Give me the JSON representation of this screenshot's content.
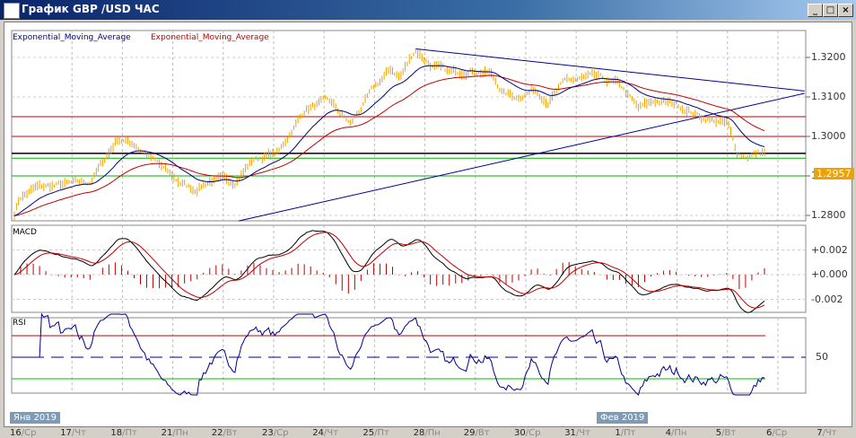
{
  "window": {
    "title": "График GBP /USD ЧАС",
    "buttons": {
      "minimize": "_",
      "maximize": "□",
      "close": "×"
    }
  },
  "legend": {
    "ema1": "Exponential_Moving_Average",
    "ema2": "Exponential_Moving_Average"
  },
  "panels": {
    "macd": "MACD",
    "rsi": "RSI"
  },
  "colors": {
    "price": "#f0a000",
    "ema_fast": "#000080",
    "ema_slow": "#c00000",
    "support": "#00b000",
    "resistance": "#c00000",
    "trend": "#000090"
  },
  "chart_data": {
    "type": "line",
    "price_axis": {
      "ticks": [
        "1.3200",
        "1.3100",
        "1.3000",
        "1.2900",
        "1.2800"
      ],
      "range": [
        1.2775,
        1.3265
      ],
      "last_price": "1.2957"
    },
    "macd_axis": {
      "ticks": [
        "+0.002",
        "+0.000",
        "-0.002"
      ]
    },
    "rsi_axis": {
      "ticks": [
        "50"
      ],
      "levels": [
        70,
        50,
        30
      ]
    },
    "horizontal_lines": [
      {
        "price": 1.305,
        "color": "red"
      },
      {
        "price": 1.3,
        "color": "red"
      },
      {
        "price": 1.2957,
        "color": "black"
      },
      {
        "price": 1.2945,
        "color": "green"
      },
      {
        "price": 1.29,
        "color": "green"
      }
    ],
    "trendlines": [
      {
        "from": [
          7.95,
          1.3222
        ],
        "to": [
          15.67,
          1.3115
        ]
      },
      {
        "from": [
          4.45,
          1.2786
        ],
        "to": [
          15.67,
          1.3109
        ]
      }
    ],
    "price_path_day_index": [
      [
        0,
        1.2805
      ],
      [
        0.1,
        1.2845
      ],
      [
        0.44,
        1.287
      ],
      [
        1.51,
        1.2885
      ],
      [
        2.05,
        1.2995
      ],
      [
        2.4,
        1.298
      ],
      [
        2.85,
        1.293
      ],
      [
        3.2,
        1.289
      ],
      [
        3.56,
        1.2865
      ],
      [
        3.91,
        1.289
      ],
      [
        4.36,
        1.2885
      ],
      [
        4.72,
        1.294
      ],
      [
        5.25,
        1.296
      ],
      [
        5.52,
        1.302
      ],
      [
        5.78,
        1.307
      ],
      [
        6.23,
        1.309
      ],
      [
        6.67,
        1.303
      ],
      [
        7.12,
        1.312
      ],
      [
        7.47,
        1.317
      ],
      [
        7.65,
        1.315
      ],
      [
        7.95,
        1.322
      ],
      [
        8.27,
        1.318
      ],
      [
        8.63,
        1.316
      ],
      [
        9.07,
        1.317
      ],
      [
        9.43,
        1.316
      ],
      [
        9.7,
        1.311
      ],
      [
        9.96,
        1.31
      ],
      [
        10.32,
        1.312
      ],
      [
        10.59,
        1.309
      ],
      [
        10.94,
        1.314
      ],
      [
        11.48,
        1.315
      ],
      [
        12.01,
        1.313
      ],
      [
        12.37,
        1.307
      ],
      [
        12.72,
        1.309
      ],
      [
        13.17,
        1.308
      ],
      [
        13.61,
        1.305
      ],
      [
        14.15,
        1.303
      ],
      [
        14.32,
        1.296
      ],
      [
        14.5,
        1.295
      ],
      [
        14.86,
        1.296
      ]
    ],
    "x_labels": [
      {
        "d": "16",
        "w": "Ср"
      },
      {
        "d": "17",
        "w": "Чт"
      },
      {
        "d": "18",
        "w": "Пт"
      },
      {
        "d": "21",
        "w": "Пн"
      },
      {
        "d": "22",
        "w": "Вт"
      },
      {
        "d": "23",
        "w": "Ср"
      },
      {
        "d": "24",
        "w": "Чт"
      },
      {
        "d": "25",
        "w": "Пт"
      },
      {
        "d": "28",
        "w": "Пн"
      },
      {
        "d": "29",
        "w": "Вт"
      },
      {
        "d": "30",
        "w": "Ср"
      },
      {
        "d": "31",
        "w": "Чт"
      },
      {
        "d": "1",
        "w": "Пт"
      },
      {
        "d": "4",
        "w": "Пн"
      },
      {
        "d": "5",
        "w": "Вт"
      },
      {
        "d": "6",
        "w": "Ср"
      },
      {
        "d": "7",
        "w": "Чт"
      }
    ],
    "months": [
      "Янв 2019",
      "Фев 2019"
    ]
  }
}
